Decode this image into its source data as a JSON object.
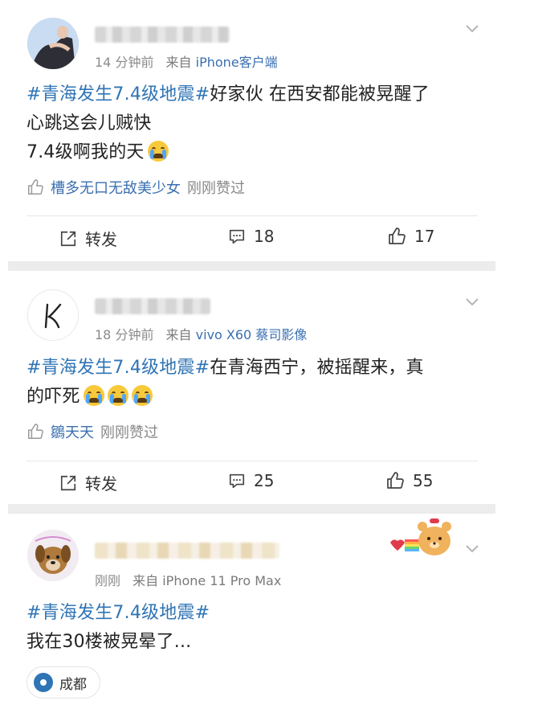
{
  "posts": [
    {
      "time": "14 分钟前",
      "source_prefix": "来自",
      "source": "iPhone客户端",
      "hashtag": "#青海发生7.4级地震#",
      "body_line1": "好家伙 在西安都能被晃醒了",
      "body_line2": "心跳这会儿贼快",
      "body_line3": "7.4级啊我的天",
      "liked_by": "槽多无口无敌美少女",
      "liked_text": "刚刚赞过",
      "repost_label": "转发",
      "comment_count": "18",
      "like_count": "17"
    },
    {
      "time": "18 分钟前",
      "source_prefix": "来自",
      "source": "vivo X60 蔡司影像",
      "hashtag": "#青海发生7.4级地震#",
      "body_line1": "在青海西宁，被摇醒来，真",
      "body_line2": "的吓死",
      "liked_by": "鶵天天",
      "liked_text": "刚刚赞过",
      "repost_label": "转发",
      "comment_count": "25",
      "like_count": "55"
    },
    {
      "time": "刚刚",
      "source_prefix": "来自",
      "source": "iPhone 11 Pro Max",
      "hashtag": "#青海发生7.4级地震#",
      "body_line1": "我在30楼被晃晕了...",
      "location": "成都"
    }
  ],
  "icons": {
    "menu": "chevron-down-icon",
    "repost": "share-icon",
    "comment": "comment-icon",
    "like": "thumbs-up-icon",
    "emoji": "crying-face-emoji",
    "location": "location-pin-icon"
  },
  "colors": {
    "link": "#2f74b5",
    "meta": "#8b8b8b",
    "separator": "#ececec"
  }
}
